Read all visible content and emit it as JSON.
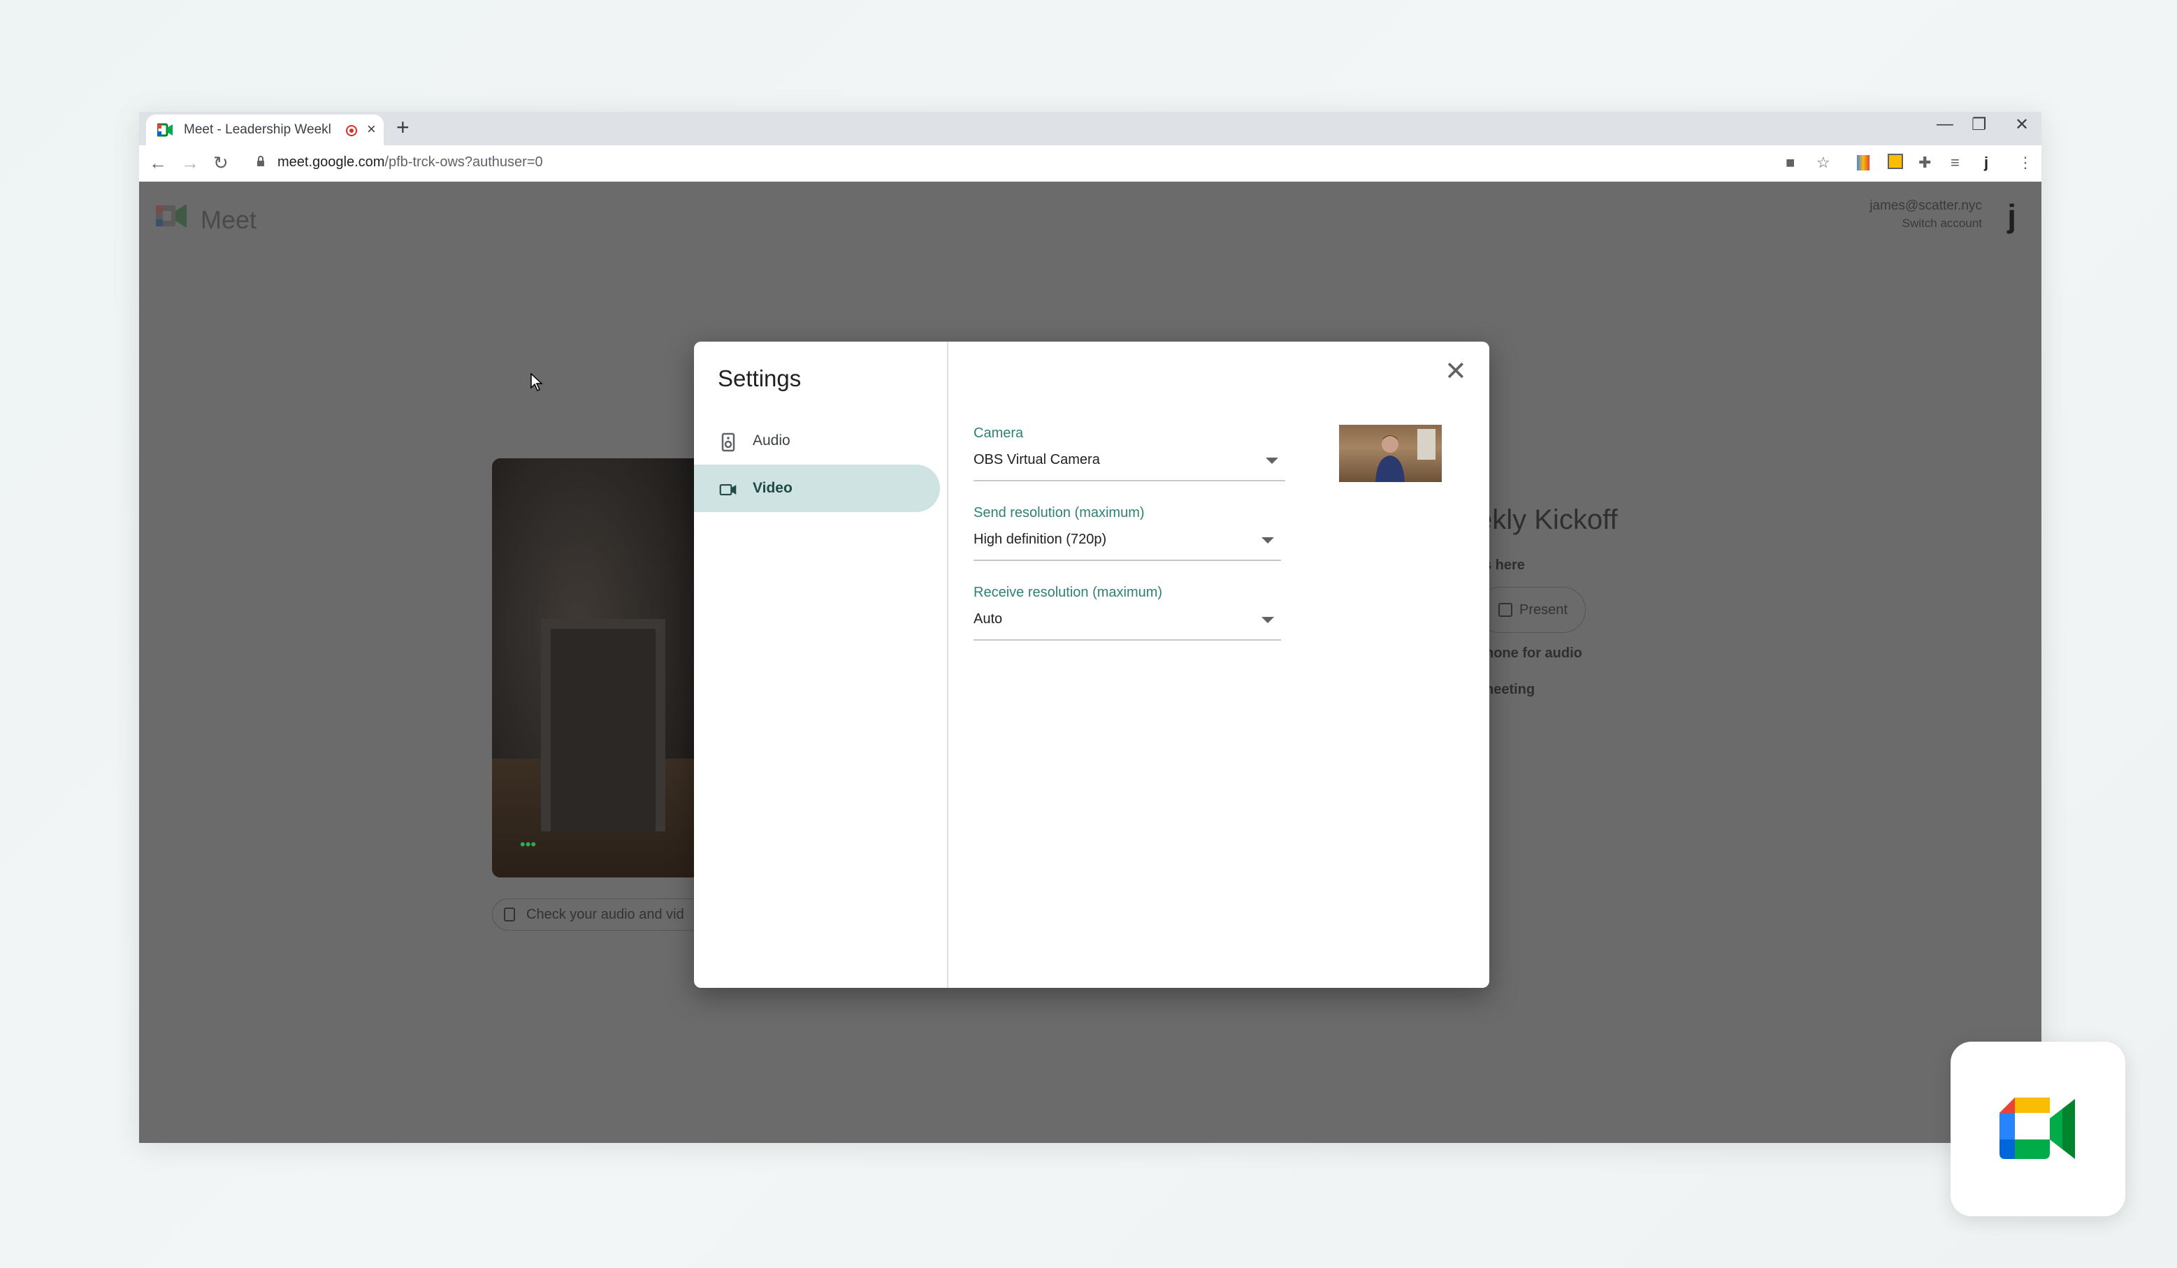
{
  "browser": {
    "tab_title": "Meet - Leadership Weekly K",
    "tab_close": "×",
    "new_tab": "+",
    "window_controls": {
      "minimize": "—",
      "restore": "❐",
      "close": "✕"
    },
    "nav": {
      "back": "←",
      "forward": "→",
      "reload": "↻"
    },
    "url": {
      "host": "meet.google.com",
      "path": "/pfb-trck-ows?authuser=0"
    },
    "extensions": [
      "camera-icon",
      "star-icon",
      "extension-icon",
      "calendar-icon",
      "puzzle-icon",
      "media-icon",
      "profile-j-icon",
      "menu-icon"
    ],
    "ext_glyphs": {
      "camera": "■",
      "star": "☆",
      "puzzle": "✚",
      "media": "≡",
      "profile": "j",
      "menu": "⋮"
    }
  },
  "meet": {
    "logo_word": "Meet",
    "account_email": "james@scatter.nyc",
    "switch_account": "Switch account",
    "avatar_letter": "j",
    "check_audio_video": "Check your audio and vid",
    "meeting_title_fragment": "ekly Kickoff",
    "others_here_fragment": "s here",
    "present_label": "Present",
    "phone_audio_fragment": "hone for audio",
    "meeting_fragment": "neeting",
    "preview_dots": "•••"
  },
  "settings": {
    "title": "Settings",
    "close_glyph": "✕",
    "nav": [
      {
        "label": "Audio",
        "icon": "speaker-icon",
        "active": false
      },
      {
        "label": "Video",
        "icon": "video-camera-icon",
        "active": true
      }
    ],
    "camera": {
      "label": "Camera",
      "value": "OBS Virtual Camera"
    },
    "send_resolution": {
      "label": "Send resolution (maximum)",
      "value": "High definition (720p)"
    },
    "receive_resolution": {
      "label": "Receive resolution (maximum)",
      "value": "Auto"
    }
  },
  "colors": {
    "accent_teal": "#2e8078",
    "active_nav_bg": "#cfe3e2",
    "overlay": "#6b6b6b",
    "record_red": "#d93025"
  }
}
